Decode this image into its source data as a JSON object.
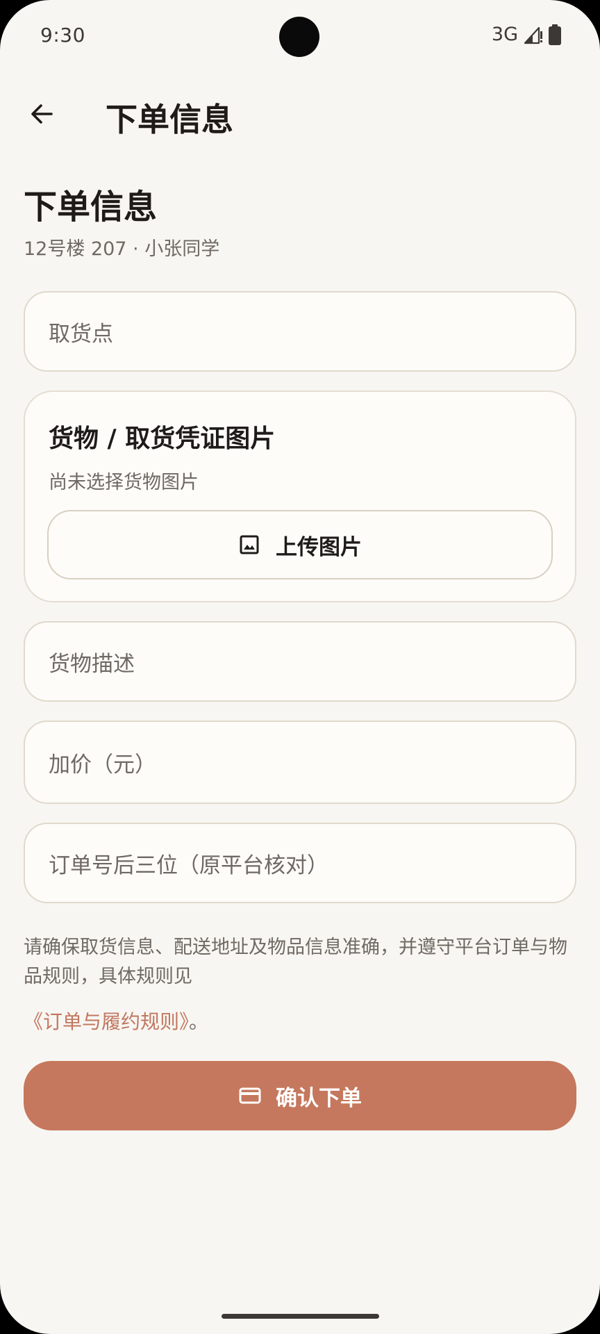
{
  "status_bar": {
    "time": "9:30",
    "network": "3G",
    "icons": [
      "signal-icon",
      "battery-icon"
    ]
  },
  "app_bar": {
    "back_icon": "arrow-left-icon",
    "title": "下单信息"
  },
  "header": {
    "heading": "下单信息",
    "subtitle": "12号楼 207 · 小张同学"
  },
  "form": {
    "pickup_point": {
      "value": "",
      "placeholder": "取货点"
    },
    "image_card": {
      "title": "货物 / 取货凭证图片",
      "hint": "尚未选择货物图片",
      "upload_label": "上传图片",
      "upload_icon": "image-icon"
    },
    "description": {
      "value": "",
      "placeholder": "货物描述"
    },
    "extra_price": {
      "value": "",
      "placeholder": "加价（元）"
    },
    "order_suffix": {
      "value": "",
      "placeholder": "订单号后三位（原平台核对）"
    }
  },
  "notice": {
    "text": "请确保取货信息、配送地址及物品信息准确，并遵守平台订单与物品规则，具体规则见",
    "link_text": "《订单与履约规则》",
    "suffix": "。"
  },
  "confirm": {
    "label": "确认下单",
    "icon": "card-icon"
  },
  "colors": {
    "background": "#f8f6f2",
    "field_background": "#fdfcf9",
    "field_border": "#e0d9cc",
    "accent": "#c5785d",
    "link": "#c17760",
    "text_primary": "#1e1b19",
    "text_secondary": "#6f6963"
  }
}
